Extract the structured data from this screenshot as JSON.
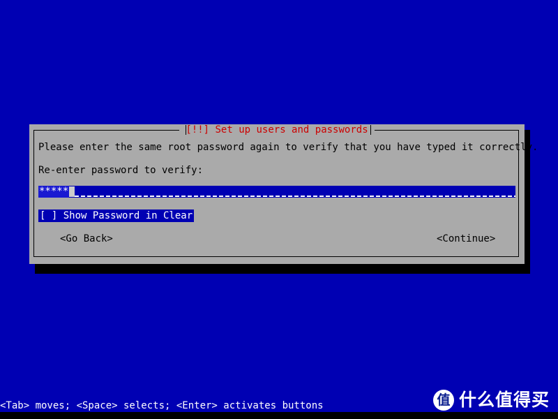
{
  "screen": {
    "background_color": "#0000b3",
    "text_color": "#ffffff"
  },
  "dialog": {
    "title": "[!!] Set up users and passwords",
    "title_color": "#cc0000",
    "panel_color": "#aaaaaa",
    "border_color": "#000000",
    "prompt": "Please enter the same root password again to verify that you have typed it correctly.",
    "field_label": "Re-enter password to verify:",
    "password": {
      "masked_value": "*****",
      "placeholder": "",
      "field_color": "#0000b3",
      "selection_color": "#1a1ad1"
    },
    "checkbox": {
      "label": "[ ] Show Password in Clear",
      "checked": false,
      "highlight_color": "#0000b3"
    },
    "buttons": {
      "back": "<Go Back>",
      "continue": "<Continue>"
    }
  },
  "statusbar": {
    "hint": "<Tab> moves; <Space> selects; <Enter> activates buttons"
  },
  "watermark": {
    "badge": "值",
    "text": "什么值得买"
  }
}
